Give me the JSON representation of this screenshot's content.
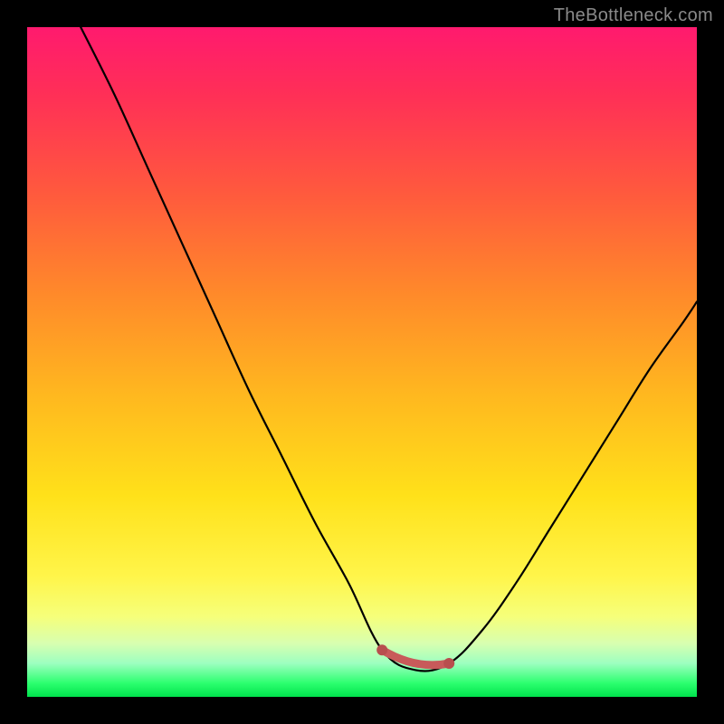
{
  "watermark": "TheBottleneck.com",
  "colors": {
    "background_black": "#000000",
    "curve_stroke": "#000000",
    "trough_marker": "#c85a5a",
    "trough_marker_dark": "#b84e4e"
  },
  "chart_data": {
    "type": "line",
    "title": "",
    "xlabel": "",
    "ylabel": "",
    "xlim": [
      0,
      100
    ],
    "ylim": [
      0,
      100
    ],
    "grid": false,
    "series": [
      {
        "name": "bottleneck-curve",
        "description": "V-shaped bottleneck curve; y is read as height from the bottom (0 at bottom, ~100 at top). Curve starts at top-left, descends steeply to a flat trough near x≈53–63 at y≈4, then rises to mid-height at the right edge.",
        "x": [
          8,
          13,
          18,
          23,
          28,
          33,
          38,
          43,
          48,
          53,
          58,
          63,
          68,
          73,
          78,
          83,
          88,
          93,
          98,
          100
        ],
        "values": [
          100,
          90,
          79,
          68,
          57,
          46,
          36,
          26,
          17,
          7,
          4,
          5,
          10,
          17,
          25,
          33,
          41,
          49,
          56,
          59
        ]
      }
    ],
    "trough_marker": {
      "x_start": 53,
      "x_end": 63,
      "y": 4
    }
  }
}
